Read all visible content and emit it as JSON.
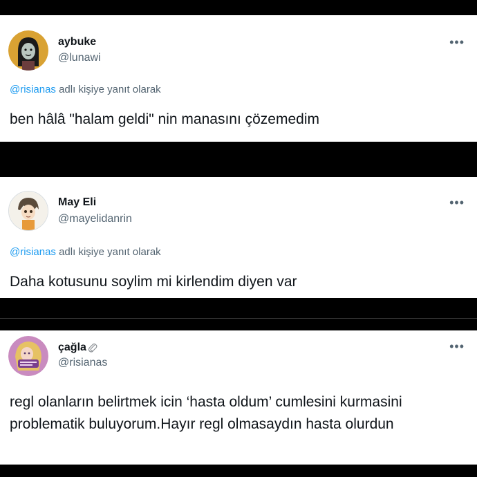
{
  "tweets": [
    {
      "name": "aybuke",
      "handle": "@lunawi",
      "reply_mention": "@risianas",
      "reply_suffix": " adlı kişiye yanıt olarak",
      "text": "ben hâlâ \"halam geldi\" nin manasını çözemedim",
      "more": "•••",
      "avatar_icon": "cartoon-girl-avatar"
    },
    {
      "name": "May Eli",
      "handle": "@mayelidanrin",
      "reply_mention": "@risianas",
      "reply_suffix": " adlı kişiye yanıt olarak",
      "text": "Daha kotusunu soylim mi kirlendim diyen var",
      "more": "•••",
      "avatar_icon": "anime-character-avatar"
    },
    {
      "name": "çağla",
      "handle": "@risianas",
      "text": "regl olanların belirtmek icin ‘hasta oldum’ cumlesini kurmasini problematik buluyorum.Hayır regl olmasaydın hasta olurdun",
      "more": "•••",
      "avatar_icon": "pink-princess-avatar",
      "name_icon": "paperclip-icon"
    }
  ],
  "colors": {
    "background": "#000000",
    "card": "#ffffff",
    "primary_text": "#0f1419",
    "secondary_text": "#536471",
    "mention": "#1d9bf0"
  }
}
